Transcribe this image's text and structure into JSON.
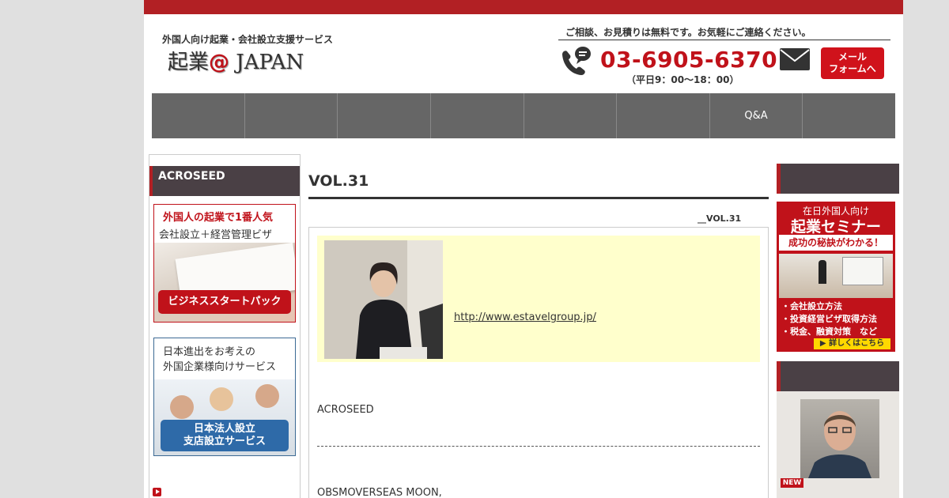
{
  "header": {
    "tagline": "外国人向け起業・会社設立支援サービス",
    "logo_main": "起業",
    "logo_at": "@",
    "logo_sub": "JAPAN",
    "consult_text": "ご相談、お見積りは無料です。お気軽にご連絡ください。",
    "phone": "03-6905-6370",
    "hours": "（平日9：00〜18：00）",
    "mail_btn_line1": "メール",
    "mail_btn_line2": "フォームへ"
  },
  "nav": {
    "items": [
      "",
      "",
      "",
      "",
      "",
      "",
      "Q&A",
      ""
    ]
  },
  "left_sidebar": {
    "heading": "ACROSEED",
    "banner1": {
      "title": "外国人の起業で1番人気",
      "subtitle": "会社設立＋経営管理ビザ",
      "button": "ビジネススタートパック"
    },
    "banner2": {
      "line1": "日本進出をお考えの",
      "line2": "外国企業様向けサービス",
      "button_line1": "日本法人設立",
      "button_line2": "支店設立サービス"
    }
  },
  "main": {
    "title": "VOL.31",
    "vol_label": "__VOL.31",
    "link": "http://www.estavelgroup.jp/",
    "line1": "ACROSEED",
    "line2": "OBSMOVERSEAS MOON,"
  },
  "right_sidebar": {
    "seminar": {
      "top": "在日外国人向け",
      "title": "起業セミナー",
      "banner": "成功の秘訣がわかる！",
      "items": [
        "・会社設立方法",
        "・投資経営ビザ取得方法",
        "・税金、融資対策　など"
      ],
      "more": "▶ 詳しくはこちら"
    },
    "new_badge": "NEW"
  },
  "colors": {
    "brand_red": "#b22024",
    "nav_gray": "#666666",
    "header_dark": "#4a4045",
    "profile_bg": "#ffffcc"
  }
}
